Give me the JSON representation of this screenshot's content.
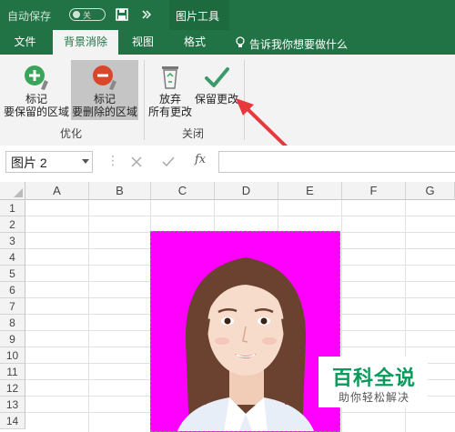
{
  "titlebar": {
    "autosave_label": "自动保存",
    "autosave_state": "关",
    "context_tools": "图片工具",
    "save_icon": "save-icon",
    "undo_icon": "undo-icon",
    "more_icon": "more-icon"
  },
  "tabs": [
    {
      "label": "文件"
    },
    {
      "label": "背景消除"
    },
    {
      "label": "视图"
    },
    {
      "label": "格式"
    }
  ],
  "tell_me": "告诉我你想要做什么",
  "ribbon": {
    "mark_keep": {
      "line1": "标记",
      "line2": "要保留的区域"
    },
    "mark_remove": {
      "line1": "标记",
      "line2": "要删除的区域"
    },
    "discard": {
      "line1": "放弃",
      "line2": "所有更改"
    },
    "keep_changes": {
      "line1": "保留更改"
    },
    "group_refine": "优化",
    "group_close": "关闭"
  },
  "formula_bar": {
    "name_box": "图片 2",
    "fx": "fx",
    "value": ""
  },
  "columns": [
    "A",
    "B",
    "C",
    "D",
    "E",
    "F",
    "G"
  ],
  "rows": [
    "1",
    "2",
    "3",
    "4",
    "5",
    "6",
    "7",
    "8",
    "9",
    "10",
    "11",
    "12",
    "13",
    "14"
  ],
  "watermark": {
    "title": "百科全说",
    "subtitle": "助你轻松解决"
  },
  "colors": {
    "excel_green": "#217346",
    "background_removal_magenta": "#ff00ff",
    "annotation_arrow": "#e8383d"
  }
}
